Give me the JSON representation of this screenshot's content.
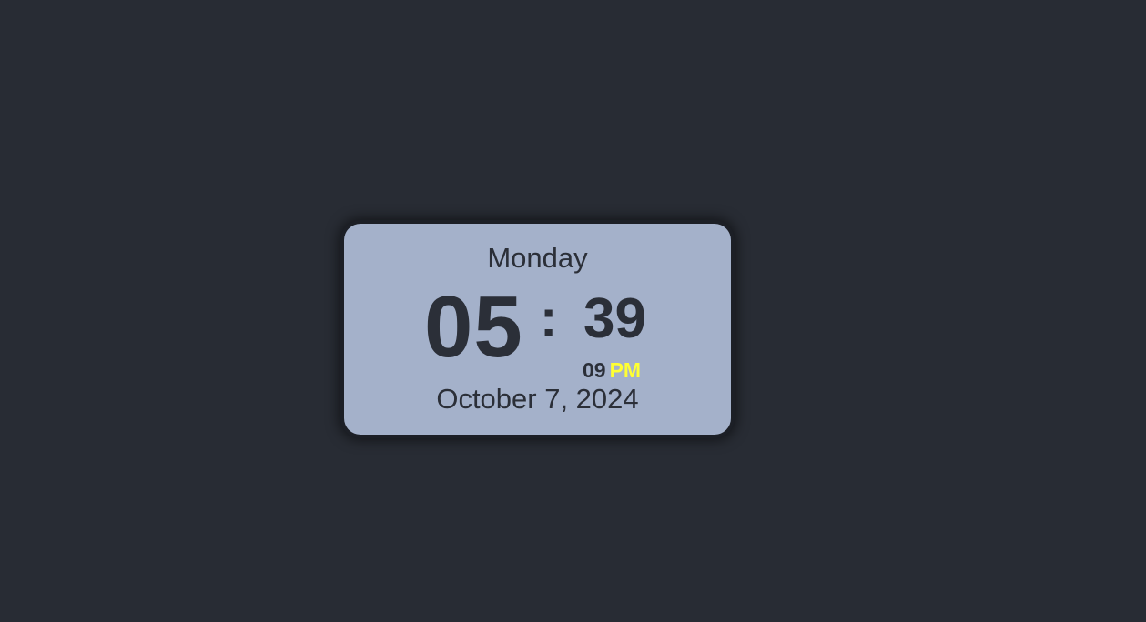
{
  "clock": {
    "day": "Monday",
    "hours": "05",
    "separator": ":",
    "minutes": "39",
    "seconds": "09",
    "period": "PM",
    "date": "October 7, 2024"
  },
  "colors": {
    "background": "#282c34",
    "card": "#a4b1ca",
    "text": "#2b2f38",
    "period_accent": "#ffff33"
  }
}
